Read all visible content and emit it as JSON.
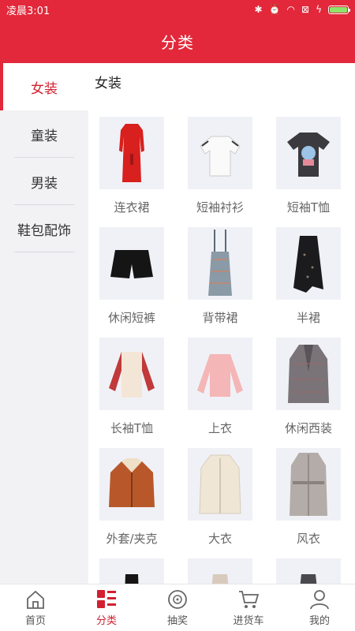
{
  "status_bar": {
    "time": "凌晨3:01",
    "battery_level": 1.0
  },
  "header": {
    "title": "分类"
  },
  "sidebar": {
    "items": [
      {
        "label": "女装",
        "active": true
      },
      {
        "label": "童装",
        "active": false
      },
      {
        "label": "男装",
        "active": false
      },
      {
        "label": "鞋包配饰",
        "active": false
      }
    ]
  },
  "content": {
    "section_title": "女装",
    "items": [
      {
        "label": "连衣裙",
        "icon": "red-dress"
      },
      {
        "label": "短袖衬衫",
        "icon": "white-blouse"
      },
      {
        "label": "短袖T恤",
        "icon": "graphic-tshirt"
      },
      {
        "label": "休闲短裤",
        "icon": "black-shorts"
      },
      {
        "label": "背带裙",
        "icon": "pinafore-dress"
      },
      {
        "label": "半裙",
        "icon": "black-skirt"
      },
      {
        "label": "长袖T恤",
        "icon": "raglan-tshirt"
      },
      {
        "label": "上衣",
        "icon": "pink-sweater"
      },
      {
        "label": "休闲西装",
        "icon": "plaid-blazer"
      },
      {
        "label": "外套/夹克",
        "icon": "orange-jacket"
      },
      {
        "label": "大衣",
        "icon": "beige-coat"
      },
      {
        "label": "风衣",
        "icon": "trench-coat"
      }
    ]
  },
  "bottom_nav": {
    "items": [
      {
        "label": "首页",
        "icon": "home-icon",
        "active": false
      },
      {
        "label": "分类",
        "icon": "category-icon",
        "active": true
      },
      {
        "label": "抽奖",
        "icon": "lottery-icon",
        "active": false
      },
      {
        "label": "进货车",
        "icon": "cart-icon",
        "active": false
      },
      {
        "label": "我的",
        "icon": "user-icon",
        "active": false
      }
    ]
  },
  "colors": {
    "brand": "#e2283a",
    "active_text": "#d22030",
    "sidebar_bg": "#f2f2f5"
  }
}
